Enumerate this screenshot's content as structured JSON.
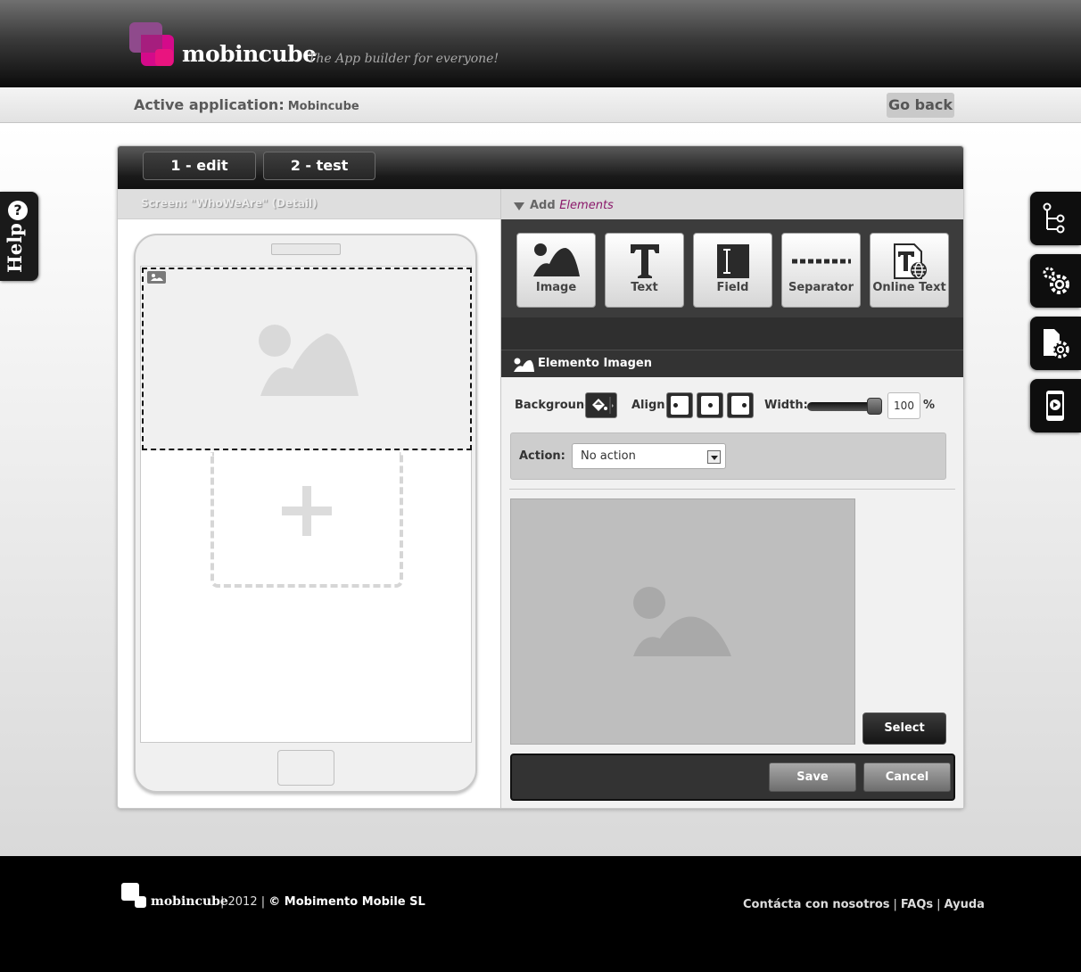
{
  "header": {
    "logo_text": "mobincube",
    "tagline": "The App builder for everyone!"
  },
  "app_bar": {
    "label": "Active application:",
    "app_name": "Mobincube",
    "go_back": "Go back"
  },
  "help_tab": {
    "icon_text": "?",
    "label": "Help"
  },
  "right_tabs": [
    {
      "icon": "tree-icon"
    },
    {
      "icon": "settings-icon"
    },
    {
      "icon": "document-settings-icon"
    },
    {
      "icon": "phone-preview-icon"
    }
  ],
  "steps": [
    {
      "label": "1 - edit"
    },
    {
      "label": "2 - test"
    }
  ],
  "screen": {
    "label": "Screen: \"WhoWeAre\" (Detail)"
  },
  "add_panel": {
    "prefix": "Add",
    "suffix": "Elements"
  },
  "tools": [
    {
      "label": "Image",
      "icon": "image-icon"
    },
    {
      "label": "Text",
      "icon": "text-icon"
    },
    {
      "label": "Field",
      "icon": "field-icon"
    },
    {
      "label": "Separator",
      "icon": "separator-icon"
    },
    {
      "label": "Online Text",
      "icon": "online-text-icon"
    }
  ],
  "element": {
    "title": "Elemento Imagen",
    "background_label": "Background:",
    "align_label": "Align:",
    "width_label": "Width:",
    "width_value": "100",
    "width_unit": "%",
    "width_fraction": 1.0,
    "action_label": "Action:",
    "action_value": "No action",
    "select_label": "Select",
    "save_label": "Save",
    "cancel_label": "Cancel"
  },
  "footer": {
    "brand": "mobincube",
    "year": "2012",
    "company": "© Mobimento Mobile SL",
    "links": [
      "Contácta con nosotros",
      "FAQs",
      "Ayuda"
    ]
  },
  "colors": {
    "accent": "#8b1a6b",
    "logo_pink": "#d40a8a",
    "logo_purple": "#8a3a86"
  }
}
